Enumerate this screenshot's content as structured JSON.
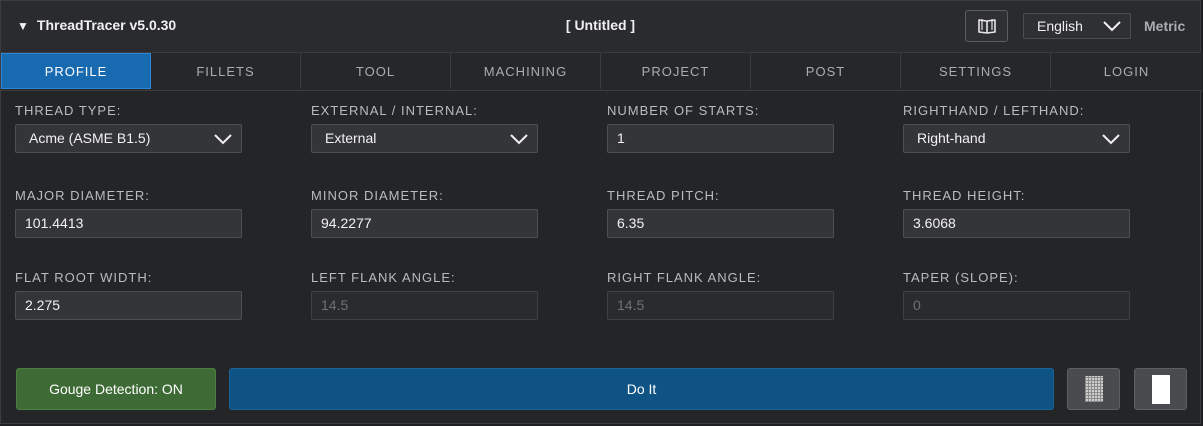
{
  "app": {
    "title": "ThreadTracer v5.0.30",
    "caret": "▼",
    "document_title": "[ Untitled ]",
    "language": "English",
    "units": "Metric",
    "icons": {
      "manual": "book-icon",
      "language_dropdown": "chevron-down-icon"
    }
  },
  "tabs": [
    {
      "label": "PROFILE",
      "active": true
    },
    {
      "label": "FILLETS"
    },
    {
      "label": "TOOL"
    },
    {
      "label": "MACHINING"
    },
    {
      "label": "PROJECT"
    },
    {
      "label": "POST"
    },
    {
      "label": "SETTINGS"
    },
    {
      "label": "LOGIN"
    }
  ],
  "fields": {
    "thread_type": {
      "label": "THREAD TYPE:",
      "value": "Acme (ASME B1.5)"
    },
    "ext_int": {
      "label": "EXTERNAL / INTERNAL:",
      "value": "External"
    },
    "starts": {
      "label": "NUMBER OF STARTS:",
      "value": "1"
    },
    "hand": {
      "label": "RIGHTHAND / LEFTHAND:",
      "value": "Right-hand"
    },
    "major_diameter": {
      "label": "MAJOR DIAMETER:",
      "value": "101.4413"
    },
    "minor_diameter": {
      "label": "MINOR DIAMETER:",
      "value": "94.2277"
    },
    "thread_pitch": {
      "label": "THREAD PITCH:",
      "value": "6.35"
    },
    "thread_height": {
      "label": "THREAD HEIGHT:",
      "value": "3.6068"
    },
    "flat_root_width": {
      "label": "FLAT ROOT WIDTH:",
      "value": "2.275"
    },
    "left_flank_angle": {
      "label": "LEFT FLANK ANGLE:",
      "value": "14.5",
      "disabled": true
    },
    "right_flank_angle": {
      "label": "RIGHT FLANK ANGLE:",
      "value": "14.5",
      "disabled": true
    },
    "taper": {
      "label": "TAPER (SLOPE):",
      "value": "0",
      "disabled": true
    }
  },
  "actions": {
    "gouge_detection": "Gouge Detection: ON",
    "do_it": "Do It",
    "icons": {
      "pattern": "pattern-icon",
      "white_square": "white-square-icon"
    }
  },
  "colors": {
    "active_tab": "#1769b0",
    "gouge_button": "#3e6b35",
    "do_it_button": "#0f5384",
    "background": "#242527"
  }
}
